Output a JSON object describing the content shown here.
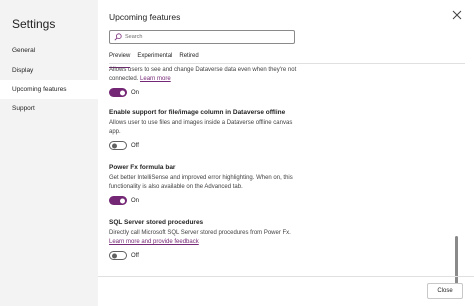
{
  "sidebar": {
    "title": "Settings",
    "items": [
      {
        "label": "General",
        "active": false
      },
      {
        "label": "Display",
        "active": false
      },
      {
        "label": "Upcoming features",
        "active": true
      },
      {
        "label": "Support",
        "active": false
      }
    ]
  },
  "main": {
    "title": "Upcoming features",
    "search": {
      "placeholder": "Search",
      "value": ""
    },
    "tabs": [
      {
        "label": "Preview",
        "active": true
      },
      {
        "label": "Experimental",
        "active": false
      },
      {
        "label": "Retired",
        "active": false
      }
    ],
    "features": [
      {
        "title": "",
        "description": "Allows users to see and change Dataverse data even when they're not connected.",
        "link": "Learn more",
        "toggle_label": "On",
        "enabled": true
      },
      {
        "title": "Enable support for file/image column in Dataverse offline",
        "description": "Allows user to use files and images inside a Dataverse offline canvas app.",
        "link": "",
        "toggle_label": "Off",
        "enabled": false
      },
      {
        "title": "Power Fx formula bar",
        "description": "Get better IntelliSense and improved error highlighting. When on, this functionality is also available on the Advanced tab.",
        "link": "",
        "toggle_label": "On",
        "enabled": true
      },
      {
        "title": "SQL Server stored procedures",
        "description": "Directly call Microsoft SQL Server stored procedures from Power Fx.",
        "link": "Learn more and provide feedback",
        "toggle_label": "Off",
        "enabled": false
      }
    ]
  },
  "footer": {
    "close_label": "Close"
  },
  "colors": {
    "accent": "#742774",
    "sidebar_bg": "#f3f3f3"
  },
  "icons": {
    "search": "search-icon",
    "close": "close-icon"
  }
}
